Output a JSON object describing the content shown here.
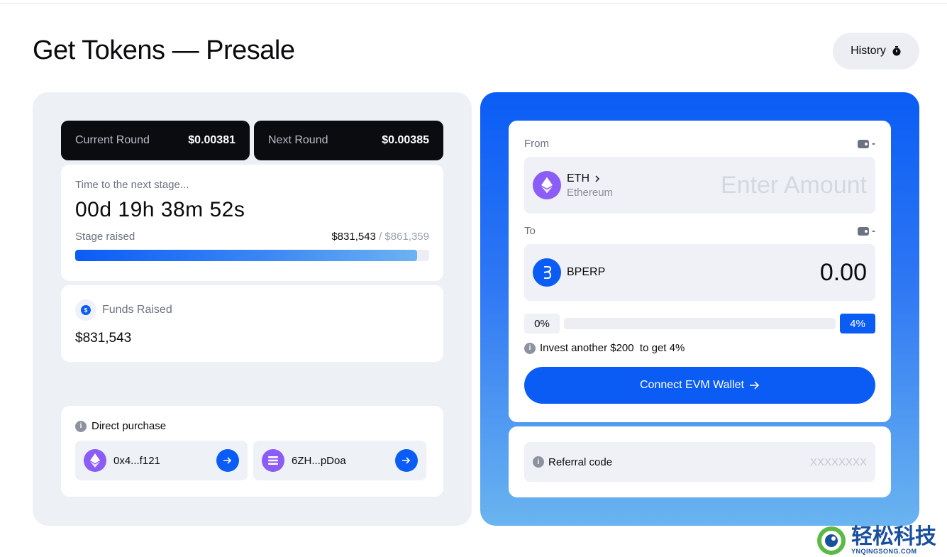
{
  "page": {
    "title": "Get Tokens — Presale",
    "history_label": "History"
  },
  "rounds": {
    "current_label": "Current Round",
    "current_value": "$0.00381",
    "next_label": "Next Round",
    "next_value": "$0.00385"
  },
  "timer": {
    "caption": "Time to the next stage...",
    "countdown": "00d 19h 38m 52s",
    "stage_label": "Stage raised",
    "stage_raised": "$831,543",
    "stage_separator": " / ",
    "stage_target": "$861,359",
    "progress_fraction": 0.965
  },
  "funds": {
    "label": "Funds Raised",
    "value": "$831,543"
  },
  "direct_purchase": {
    "label": "Direct purchase",
    "addresses": [
      {
        "chain_icon": "ethereum-icon",
        "address": "0x4...f121"
      },
      {
        "chain_icon": "solana-icon",
        "address": "6ZH...pDoa"
      }
    ]
  },
  "swap": {
    "from_label": "From",
    "from_balance": "-",
    "from_token": "ETH",
    "from_network": "Ethereum",
    "amount_placeholder": "Enter Amount",
    "to_label": "To",
    "to_balance": "-",
    "to_token": "BPERP",
    "to_amount": "0.00",
    "bonus_start": "0%",
    "bonus_end": "4%",
    "bonus_progress_fraction": 0,
    "invest_note": "Invest another $200  to get 4%",
    "connect_label": "Connect EVM Wallet"
  },
  "referral": {
    "label": "Referral code",
    "placeholder": "XXXXXXXX"
  },
  "watermark": {
    "cn": "轻松科技",
    "en": "YNQINGSONG.COM"
  },
  "colors": {
    "accent": "#0a5cf5",
    "dark_card": "#0b0c10",
    "panel_bg": "#edf0f5",
    "eth_purple": "#8b5cf6"
  }
}
